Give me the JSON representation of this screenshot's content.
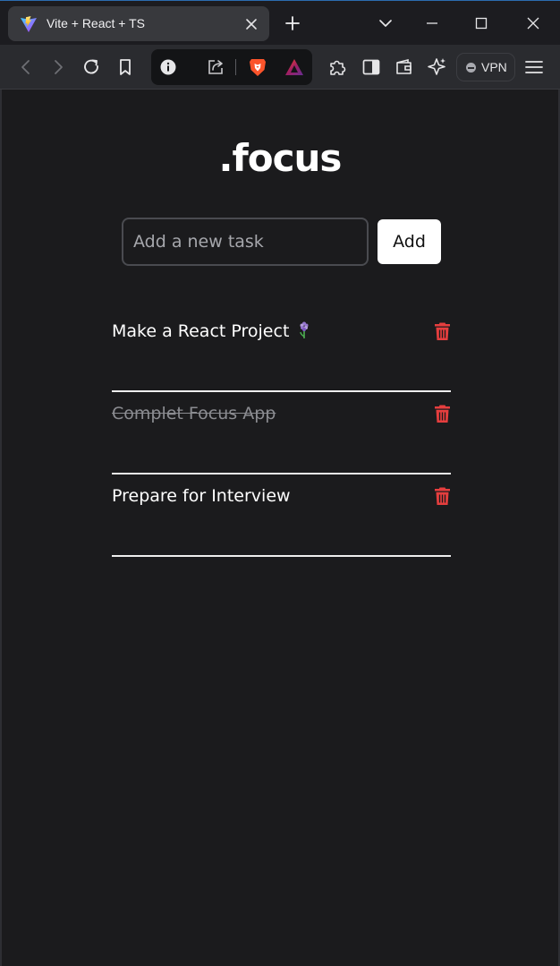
{
  "browser": {
    "tab_title": "Vite + React + TS",
    "vpn_label": "VPN",
    "accent_color": "#2b6cb0"
  },
  "icons": {
    "favicon": "vite-logo-icon",
    "tab_close": "close-icon",
    "new_tab": "plus-icon",
    "tab_list": "chevron-down-icon",
    "minimize": "minimize-icon",
    "maximize": "maximize-icon",
    "close": "close-icon",
    "back": "chevron-left-icon",
    "forward": "chevron-right-icon",
    "reload": "reload-icon",
    "bookmark": "bookmark-icon",
    "site_info": "info-icon",
    "share": "share-icon",
    "shields": "brave-lion-icon",
    "rewards": "brave-rewards-triangle-icon",
    "extensions": "puzzle-icon",
    "sidebar": "sidebar-icon",
    "wallet": "wallet-icon",
    "leo": "sparkle-star-icon",
    "menu": "hamburger-menu-icon",
    "delete": "trash-icon"
  },
  "app": {
    "title": ".focus",
    "input_placeholder": "Add a new task",
    "add_label": "Add",
    "delete_color": "#e53e3e",
    "tasks": [
      {
        "text": "Make a React Project",
        "emoji": "hyacinth-flower-icon",
        "completed": false
      },
      {
        "text": "Complet Focus App",
        "completed": true
      },
      {
        "text": "Prepare for Interview",
        "completed": false
      }
    ]
  }
}
